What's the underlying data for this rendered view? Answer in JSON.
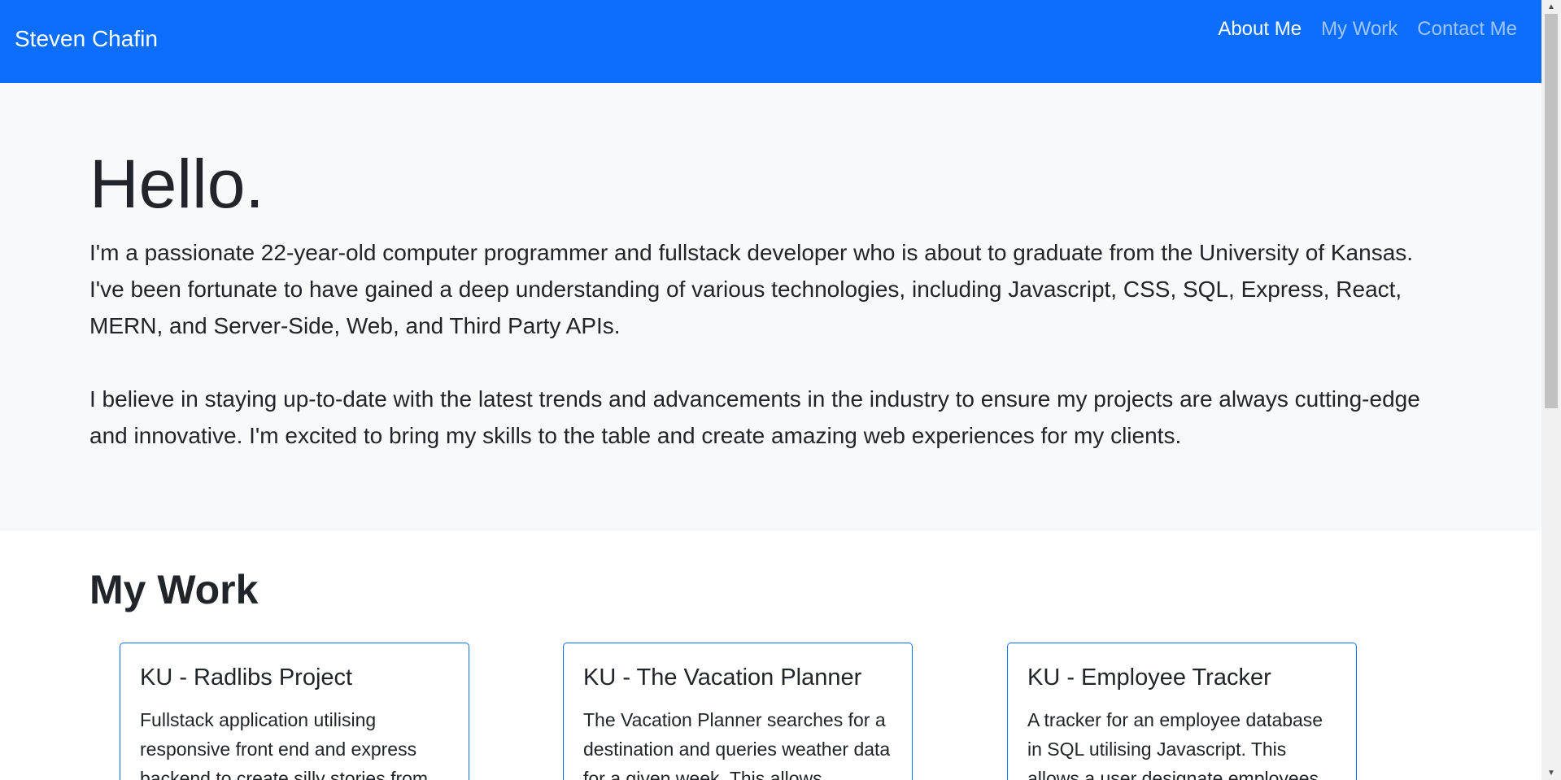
{
  "navbar": {
    "brand": "Steven Chafin",
    "links": [
      {
        "label": "About Me",
        "active": true
      },
      {
        "label": "My Work",
        "active": false
      },
      {
        "label": "Contact Me",
        "active": false
      }
    ]
  },
  "hero": {
    "title": "Hello.",
    "paragraph1": "I'm a passionate 22-year-old computer programmer and fullstack developer who is about to graduate from the University of Kansas. I've been fortunate to have gained a deep understanding of various technologies, including Javascript, CSS, SQL, Express, React, MERN, and Server-Side, Web, and Third Party APIs.",
    "paragraph2": "I believe in staying up-to-date with the latest trends and advancements in the industry to ensure my projects are always cutting-edge and innovative. I'm excited to bring my skills to the table and create amazing web experiences for my clients."
  },
  "work": {
    "title": "My Work",
    "cards": [
      {
        "title": "KU - Radlibs Project",
        "text": "Fullstack application utilising responsive front end and express backend to create silly stories from"
      },
      {
        "title": "KU - The Vacation Planner",
        "text": "The Vacation Planner searches for a destination and queries weather data for a given week. This allows"
      },
      {
        "title": "KU - Employee Tracker",
        "text": "A tracker for an employee database in SQL utilising Javascript. This allows a user designate employees"
      }
    ]
  },
  "scrollbar": {
    "up_icon": "triangle-up-icon",
    "down_icon": "triangle-down-icon"
  },
  "colors": {
    "navbar_bg": "#0d6efd",
    "hero_bg": "#f8f9fa",
    "card_border": "#0d6efd",
    "text": "#212529"
  }
}
